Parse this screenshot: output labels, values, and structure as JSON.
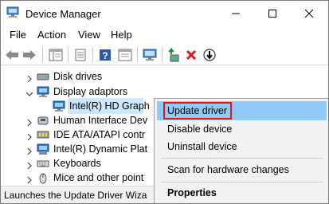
{
  "window": {
    "title": "Device Manager",
    "icon": "device-manager-icon"
  },
  "menubar": {
    "items": [
      "File",
      "Action",
      "View",
      "Help"
    ]
  },
  "toolbar": {
    "buttons": [
      "back-arrow-icon",
      "forward-arrow-icon",
      "show-hide-console-tree-icon",
      "properties-sheet-icon",
      "help-icon",
      "console-list-icon",
      "monitor-scan-icon",
      "update-driver-icon",
      "uninstall-device-icon",
      "disable-device-icon"
    ]
  },
  "tree": {
    "rows": [
      {
        "label": "Disk drives",
        "expanded": false
      },
      {
        "label": "Display adaptors",
        "expanded": true
      },
      {
        "label": "Intel(R) HD Graph",
        "selected": true
      },
      {
        "label": "Human Interface Dev",
        "expanded": false
      },
      {
        "label": "IDE ATA/ATAPI contr",
        "expanded": false
      },
      {
        "label": "Intel(R) Dynamic Plat",
        "expanded": false
      },
      {
        "label": "Keyboards",
        "expanded": false
      },
      {
        "label": "Mice and other point",
        "expanded": false
      }
    ]
  },
  "context_menu": {
    "items": [
      {
        "label": "Update driver",
        "highlighted": true,
        "boxed": true
      },
      {
        "label": "Disable device"
      },
      {
        "label": "Uninstall device"
      },
      {
        "label": "Scan for hardware changes"
      },
      {
        "label": "Properties",
        "bold": true
      }
    ]
  },
  "statusbar": {
    "text": "Launches the Update Driver Wiza"
  },
  "colors": {
    "highlight": "#91c9f7",
    "selection": "#cce8ff",
    "annotation_box": "#e0141e",
    "uninstall_x": "#e0141e"
  }
}
